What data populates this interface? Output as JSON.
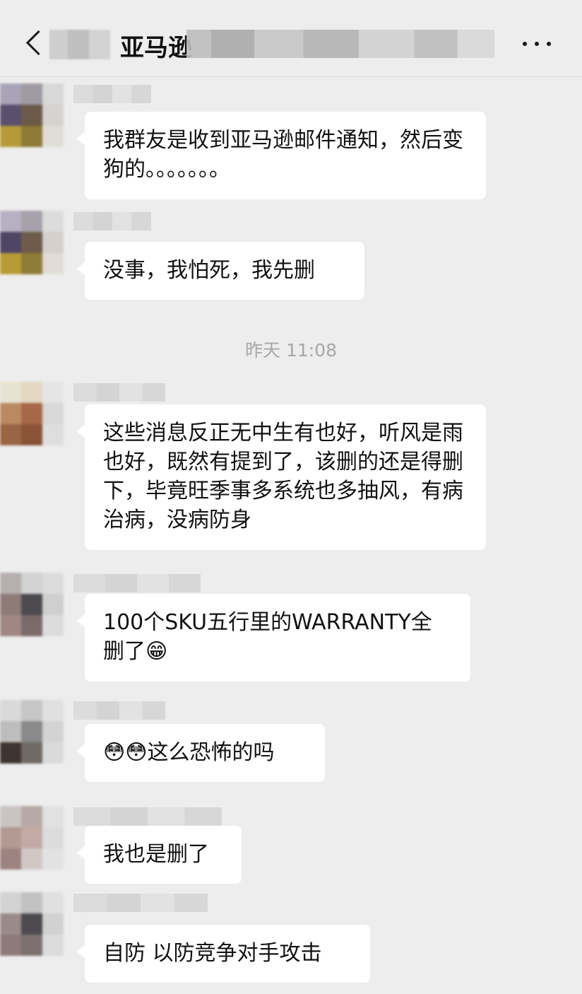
{
  "header": {
    "title": "亚马逊",
    "back_icon": "chevron-left-icon",
    "more_icon": "more-dots-icon"
  },
  "timestamp": "昨天 11:08",
  "messages": [
    {
      "text": "我群友是收到亚马逊邮件通知，然后变狗的。。。。。。。"
    },
    {
      "text": "没事，我怕死，我先删"
    },
    {
      "text": "这些消息反正无中生有也好，听风是雨也好，既然有提到了，该删的还是得删下，毕竟旺季事多系统也多抽风，有病治病，没病防身"
    },
    {
      "text": "100个SKU五行里的WARRANTY全删了😁"
    },
    {
      "text": "😳😳这么恐怖的吗"
    },
    {
      "text": "我也是删了"
    },
    {
      "text": "自防 以防竞争对手攻击"
    }
  ]
}
